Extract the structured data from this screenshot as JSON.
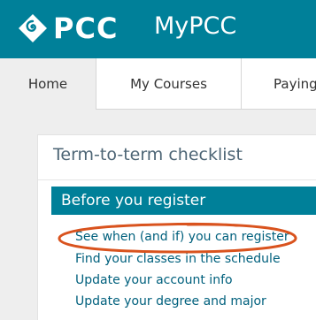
{
  "header": {
    "logo_text": "PCC",
    "app_name": "MyPCC",
    "background_color": "#008099",
    "logo_icon": "pcc-diamond-logo-icon"
  },
  "tabs": [
    {
      "label": "Home",
      "active": true
    },
    {
      "label": "My Courses",
      "active": false
    },
    {
      "label": "Paying f",
      "active": false
    }
  ],
  "card": {
    "title": "Term-to-term checklist",
    "section_header": "Before you register",
    "links": [
      "See when (and if) you can register",
      "Find your classes in the schedule",
      "Update your account info",
      "Update your degree and major"
    ]
  },
  "annotation": {
    "type": "hand-drawn-circle",
    "color": "#d9531e",
    "target": "See when (and if) you can register"
  }
}
